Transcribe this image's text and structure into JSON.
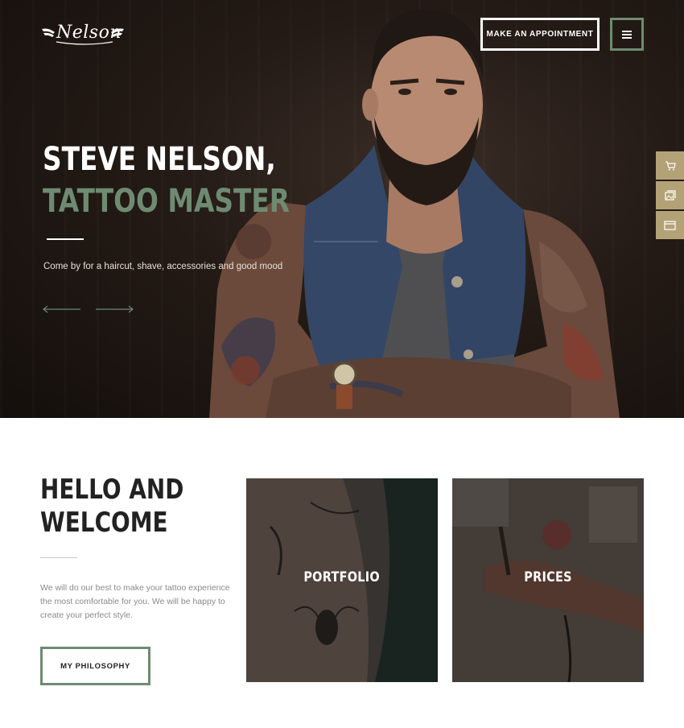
{
  "header": {
    "logo_text": "Nelson",
    "appointment_label": "MAKE AN APPOINTMENT",
    "menu_icon": "hamburger-menu-icon"
  },
  "hero": {
    "title_line1": "STEVE NELSON,",
    "title_line2": "TATTOO MASTER",
    "subtitle": "Come by for a haircut, shave, accessories and good mood",
    "prev_icon": "arrow-left-icon",
    "next_icon": "arrow-right-icon"
  },
  "side_tabs": [
    {
      "icon": "cart-icon"
    },
    {
      "icon": "gallery-icon"
    },
    {
      "icon": "browser-window-icon"
    }
  ],
  "welcome": {
    "title_line1": "HELLO AND",
    "title_line2": "WELCOME",
    "text": "We will do our best to make your tattoo experience the most comfortable for you. We will be happy to create your perfect style.",
    "button_label": "MY PHILOSOPHY"
  },
  "cards": [
    {
      "label": "PORTFOLIO"
    },
    {
      "label": "PRICES"
    }
  ],
  "colors": {
    "accent_green": "#6e8b72",
    "side_tab_gold": "#b4a277",
    "hero_dark": "#1a1310",
    "text_dark": "#222222",
    "text_muted": "#8a8a8a"
  }
}
